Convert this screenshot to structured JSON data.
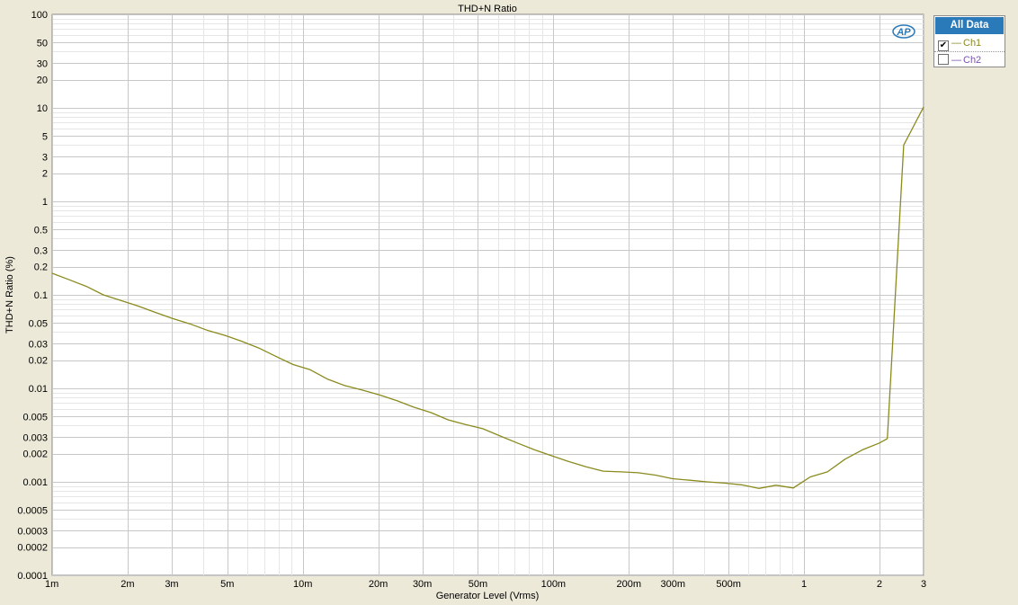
{
  "colors": {
    "ch1": "#8a8a1e",
    "ch2": "#7a52b0",
    "legend_header": "#2a79b8",
    "logo": "#2a79b8",
    "window_bg": "#ece9d8",
    "plot_bg": "#ffffff"
  },
  "logo": {
    "text": "AP"
  },
  "legend": {
    "header": "All Data",
    "items": [
      {
        "name": "Ch1",
        "checked": true,
        "check_glyph": "✔",
        "dash": "—"
      },
      {
        "name": "Ch2",
        "checked": false,
        "check_glyph": "",
        "dash": "—"
      }
    ]
  },
  "chart_data": {
    "type": "line",
    "title": "THD+N Ratio",
    "xlabel": "Generator Level (Vrms)",
    "ylabel": "THD+N Ratio (%)",
    "x_scale": "log",
    "y_scale": "log",
    "xlim": [
      0.001,
      3
    ],
    "ylim": [
      0.0001,
      100
    ],
    "grid": true,
    "legend_position": "right",
    "x_ticks": [
      {
        "value": 0.001,
        "label": "1m"
      },
      {
        "value": 0.002,
        "label": "2m"
      },
      {
        "value": 0.003,
        "label": "3m"
      },
      {
        "value": 0.005,
        "label": "5m"
      },
      {
        "value": 0.01,
        "label": "10m"
      },
      {
        "value": 0.02,
        "label": "20m"
      },
      {
        "value": 0.03,
        "label": "30m"
      },
      {
        "value": 0.05,
        "label": "50m"
      },
      {
        "value": 0.1,
        "label": "100m"
      },
      {
        "value": 0.2,
        "label": "200m"
      },
      {
        "value": 0.3,
        "label": "300m"
      },
      {
        "value": 0.5,
        "label": "500m"
      },
      {
        "value": 1,
        "label": "1"
      },
      {
        "value": 2,
        "label": "2"
      },
      {
        "value": 3,
        "label": "3"
      }
    ],
    "y_ticks": [
      {
        "value": 100,
        "label": "100"
      },
      {
        "value": 50,
        "label": "50"
      },
      {
        "value": 30,
        "label": "30"
      },
      {
        "value": 20,
        "label": "20"
      },
      {
        "value": 10,
        "label": "10"
      },
      {
        "value": 5,
        "label": "5"
      },
      {
        "value": 3,
        "label": "3"
      },
      {
        "value": 2,
        "label": "2"
      },
      {
        "value": 1,
        "label": "1"
      },
      {
        "value": 0.5,
        "label": "0.5"
      },
      {
        "value": 0.3,
        "label": "0.3"
      },
      {
        "value": 0.2,
        "label": "0.2"
      },
      {
        "value": 0.1,
        "label": "0.1"
      },
      {
        "value": 0.05,
        "label": "0.05"
      },
      {
        "value": 0.03,
        "label": "0.03"
      },
      {
        "value": 0.02,
        "label": "0.02"
      },
      {
        "value": 0.01,
        "label": "0.01"
      },
      {
        "value": 0.005,
        "label": "0.005"
      },
      {
        "value": 0.003,
        "label": "0.003"
      },
      {
        "value": 0.002,
        "label": "0.002"
      },
      {
        "value": 0.001,
        "label": "0.001"
      },
      {
        "value": 0.0005,
        "label": "0.0005"
      },
      {
        "value": 0.0003,
        "label": "0.0003"
      },
      {
        "value": 0.0002,
        "label": "0.0002"
      },
      {
        "value": 0.0001,
        "label": "0.0001"
      }
    ],
    "series": [
      {
        "name": "Ch1",
        "x": [
          0.001,
          0.00117,
          0.00137,
          0.0016,
          0.00188,
          0.0022,
          0.00258,
          0.00302,
          0.00354,
          0.00414,
          0.00486,
          0.00569,
          0.00667,
          0.00781,
          0.00915,
          0.0107,
          0.0126,
          0.0147,
          0.0172,
          0.0202,
          0.0237,
          0.0277,
          0.0325,
          0.0381,
          0.0446,
          0.0523,
          0.0612,
          0.0718,
          0.0841,
          0.0985,
          0.115,
          0.135,
          0.158,
          0.186,
          0.218,
          0.255,
          0.299,
          0.35,
          0.41,
          0.481,
          0.563,
          0.66,
          0.773,
          0.906,
          1.06,
          1.24,
          1.46,
          1.71,
          2.0,
          2.15,
          2.5,
          3.0
        ],
        "y": [
          0.17,
          0.145,
          0.123,
          0.1,
          0.087,
          0.076,
          0.065,
          0.056,
          0.049,
          0.042,
          0.037,
          0.032,
          0.027,
          0.022,
          0.018,
          0.0158,
          0.0125,
          0.0107,
          0.0096,
          0.0085,
          0.0074,
          0.0063,
          0.0055,
          0.0046,
          0.0041,
          0.0037,
          0.0031,
          0.0026,
          0.0022,
          0.0019,
          0.00165,
          0.00145,
          0.0013,
          0.00128,
          0.00125,
          0.00118,
          0.00108,
          0.00104,
          0.001,
          0.00097,
          0.00093,
          0.00085,
          0.00092,
          0.00086,
          0.00113,
          0.00128,
          0.00175,
          0.0022,
          0.0026,
          0.0029,
          4.0,
          10.2
        ]
      }
    ]
  }
}
